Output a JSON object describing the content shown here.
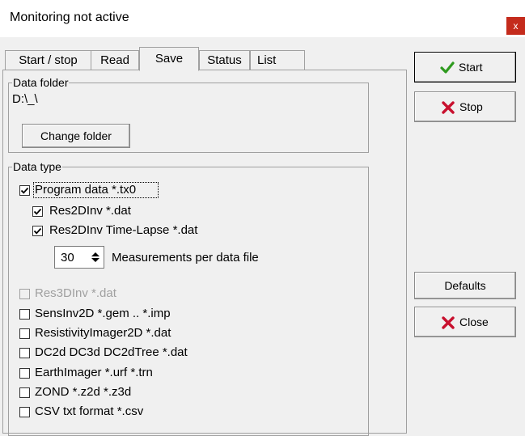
{
  "window": {
    "title": "Monitoring not active",
    "close_glyph": "x",
    "close_color": "#c42b1c"
  },
  "tabs": [
    {
      "label": "Start / stop"
    },
    {
      "label": "Read"
    },
    {
      "label": "Save",
      "active": true
    },
    {
      "label": "Status"
    },
    {
      "label": "List"
    }
  ],
  "data_folder": {
    "legend": "Data folder",
    "path": "D:\\_\\",
    "change_button": "Change folder"
  },
  "data_type": {
    "legend": "Data type",
    "program_data": {
      "label": "Program data *.tx0",
      "checked": true
    },
    "res2dinv": {
      "label": "Res2DInv *.dat",
      "checked": true
    },
    "res2dinv_timelapse": {
      "label": "Res2DInv Time-Lapse *.dat",
      "checked": true
    },
    "measurements": {
      "value": "30",
      "label": "Measurements per data file"
    },
    "res3dinv": {
      "label": "Res3DInv *.dat",
      "checked": false,
      "disabled": true
    },
    "sensinv2d": {
      "label": "SensInv2D *.gem .. *.imp",
      "checked": false
    },
    "resistivityimager2d": {
      "label": "ResistivityImager2D  *.dat",
      "checked": false
    },
    "dc2d": {
      "label": "DC2d DC3d DC2dTree *.dat",
      "checked": false
    },
    "earthimager": {
      "label": "EarthImager *.urf *.trn",
      "checked": false
    },
    "zond": {
      "label": "ZOND *.z2d *.z3d",
      "checked": false
    },
    "csv": {
      "label": "CSV txt format *.csv",
      "checked": false
    }
  },
  "right_buttons": {
    "start": "Start",
    "stop": "Stop",
    "defaults": "Defaults",
    "close": "Close"
  },
  "colors": {
    "check_green": "#2e9a1e",
    "x_red": "#c8102e"
  }
}
